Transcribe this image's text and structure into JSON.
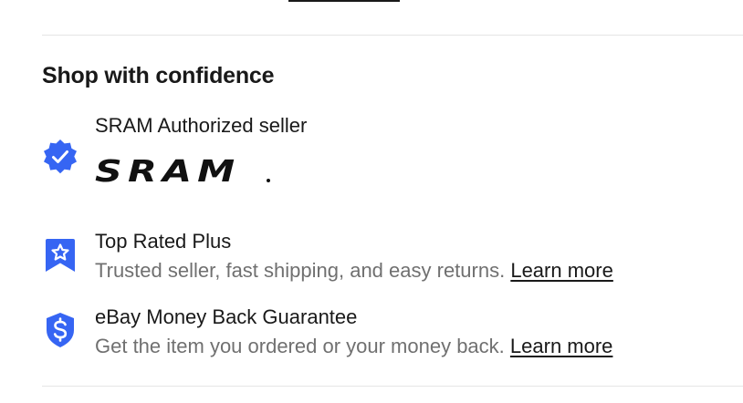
{
  "section": {
    "title": "Shop with confidence"
  },
  "features": {
    "authorized": {
      "icon": "verified-badge-icon",
      "title": "SRAM Authorized seller",
      "brand_logo_text": "SRAM"
    },
    "top_rated": {
      "icon": "bookmark-star-icon",
      "title": "Top Rated Plus",
      "description": "Trusted seller, fast shipping, and easy returns.",
      "link_label": "Learn more"
    },
    "guarantee": {
      "icon": "dollar-shield-icon",
      "title": "eBay Money Back Guarantee",
      "description": "Get the item you ordered or your money back.",
      "link_label": "Learn more"
    }
  },
  "colors": {
    "accent_blue": "#3665f3",
    "text_primary": "#191919",
    "text_secondary": "#707070",
    "divider": "#e5e5e5"
  }
}
